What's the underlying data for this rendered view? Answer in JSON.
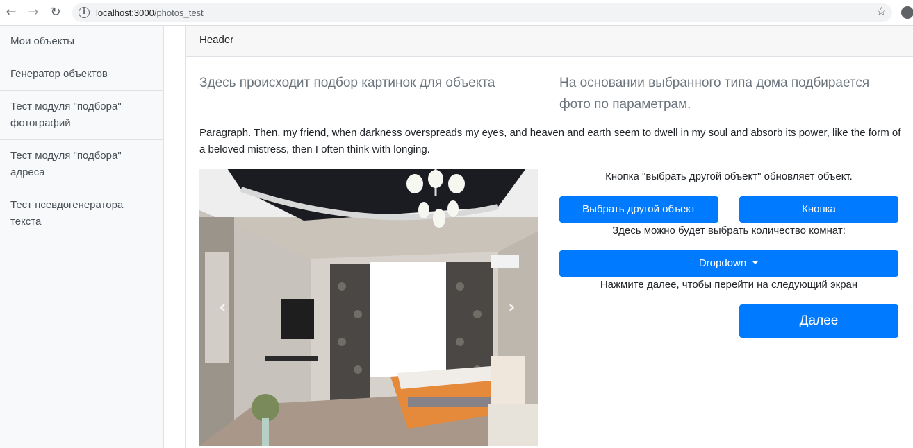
{
  "browser": {
    "url_host": "localhost:3000",
    "url_path": "/photos_test",
    "back_icon": "arrow-left-icon",
    "forward_icon": "arrow-right-icon",
    "reload_icon": "reload-icon",
    "bookmark_icon": "star-icon"
  },
  "sidebar": {
    "items": [
      {
        "label": "Мои объекты"
      },
      {
        "label": "Генератор объектов"
      },
      {
        "label": "Тест модуля \"подбора\" фотографий"
      },
      {
        "label": "Тест модуля \"подбора\" адреса"
      },
      {
        "label": "Тест псевдогенератора текста"
      }
    ]
  },
  "card": {
    "header": "Header",
    "lead_left": "Здесь происходит подбор картинок для объекта",
    "lead_right": "На основании выбранного типа дома подбирается фото по параметрам.",
    "paragraph": "Paragraph. Then, my friend, when darkness overspreads my eyes, and heaven and earth seem to dwell in my soul and absorb its power, like the form of a beloved mistress, then I often think with longing."
  },
  "carousel": {
    "prev_icon": "chevron-left-icon",
    "next_icon": "chevron-right-icon"
  },
  "controls": {
    "object_hint": "Кнопка \"выбрать другой объект\" обновляет объект.",
    "choose_other_label": "Выбрать другой объект",
    "button_label": "Кнопка",
    "rooms_hint": "Здесь можно будет выбрать количество комнат:",
    "dropdown_label": "Dropdown",
    "next_hint": "Нажмите далее, чтобы перейти на следующий экран",
    "next_label": "Далее"
  },
  "colors": {
    "primary": "#007bff",
    "sidebar_bg": "#f8f9fa",
    "header_bg": "#f7f7f7",
    "lead_text": "#6c757d"
  }
}
